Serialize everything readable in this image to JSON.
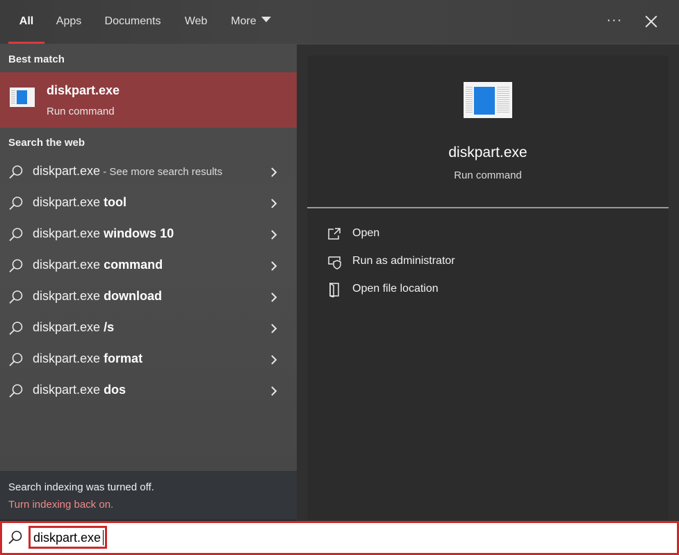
{
  "tabs": [
    {
      "label": "All",
      "active": true
    },
    {
      "label": "Apps"
    },
    {
      "label": "Documents"
    },
    {
      "label": "Web"
    },
    {
      "label": "More"
    }
  ],
  "toolbar": {
    "more_options_icon": "ellipsis-icon",
    "close_icon": "close-icon"
  },
  "best_match": {
    "section_title": "Best match",
    "name": "diskpart.exe",
    "subtitle": "Run command"
  },
  "search_web": {
    "section_title": "Search the web",
    "items": [
      {
        "query": "diskpart.exe",
        "suffix": "",
        "extra": " - See more search results"
      },
      {
        "query": "diskpart.exe ",
        "suffix": "tool",
        "extra": ""
      },
      {
        "query": "diskpart.exe ",
        "suffix": "windows 10",
        "extra": ""
      },
      {
        "query": "diskpart.exe ",
        "suffix": "command",
        "extra": ""
      },
      {
        "query": "diskpart.exe ",
        "suffix": "download",
        "extra": ""
      },
      {
        "query": "diskpart.exe ",
        "suffix": "/s",
        "extra": ""
      },
      {
        "query": "diskpart.exe ",
        "suffix": "format",
        "extra": ""
      },
      {
        "query": "diskpart.exe ",
        "suffix": "dos",
        "extra": ""
      }
    ]
  },
  "indexing": {
    "message": "Search indexing was turned off.",
    "link": "Turn indexing back on."
  },
  "preview": {
    "title": "diskpart.exe",
    "subtitle": "Run command",
    "actions": [
      {
        "label": "Open",
        "icon": "open-icon"
      },
      {
        "label": "Run as administrator",
        "icon": "shield-icon"
      },
      {
        "label": "Open file location",
        "icon": "file-location-icon"
      }
    ]
  },
  "search": {
    "value": "diskpart.exe"
  },
  "colors": {
    "accent": "#d83b3b",
    "selected_bg": "#8f3c3f",
    "highlight_border": "#cc2a2a",
    "link": "#f08a8a"
  }
}
